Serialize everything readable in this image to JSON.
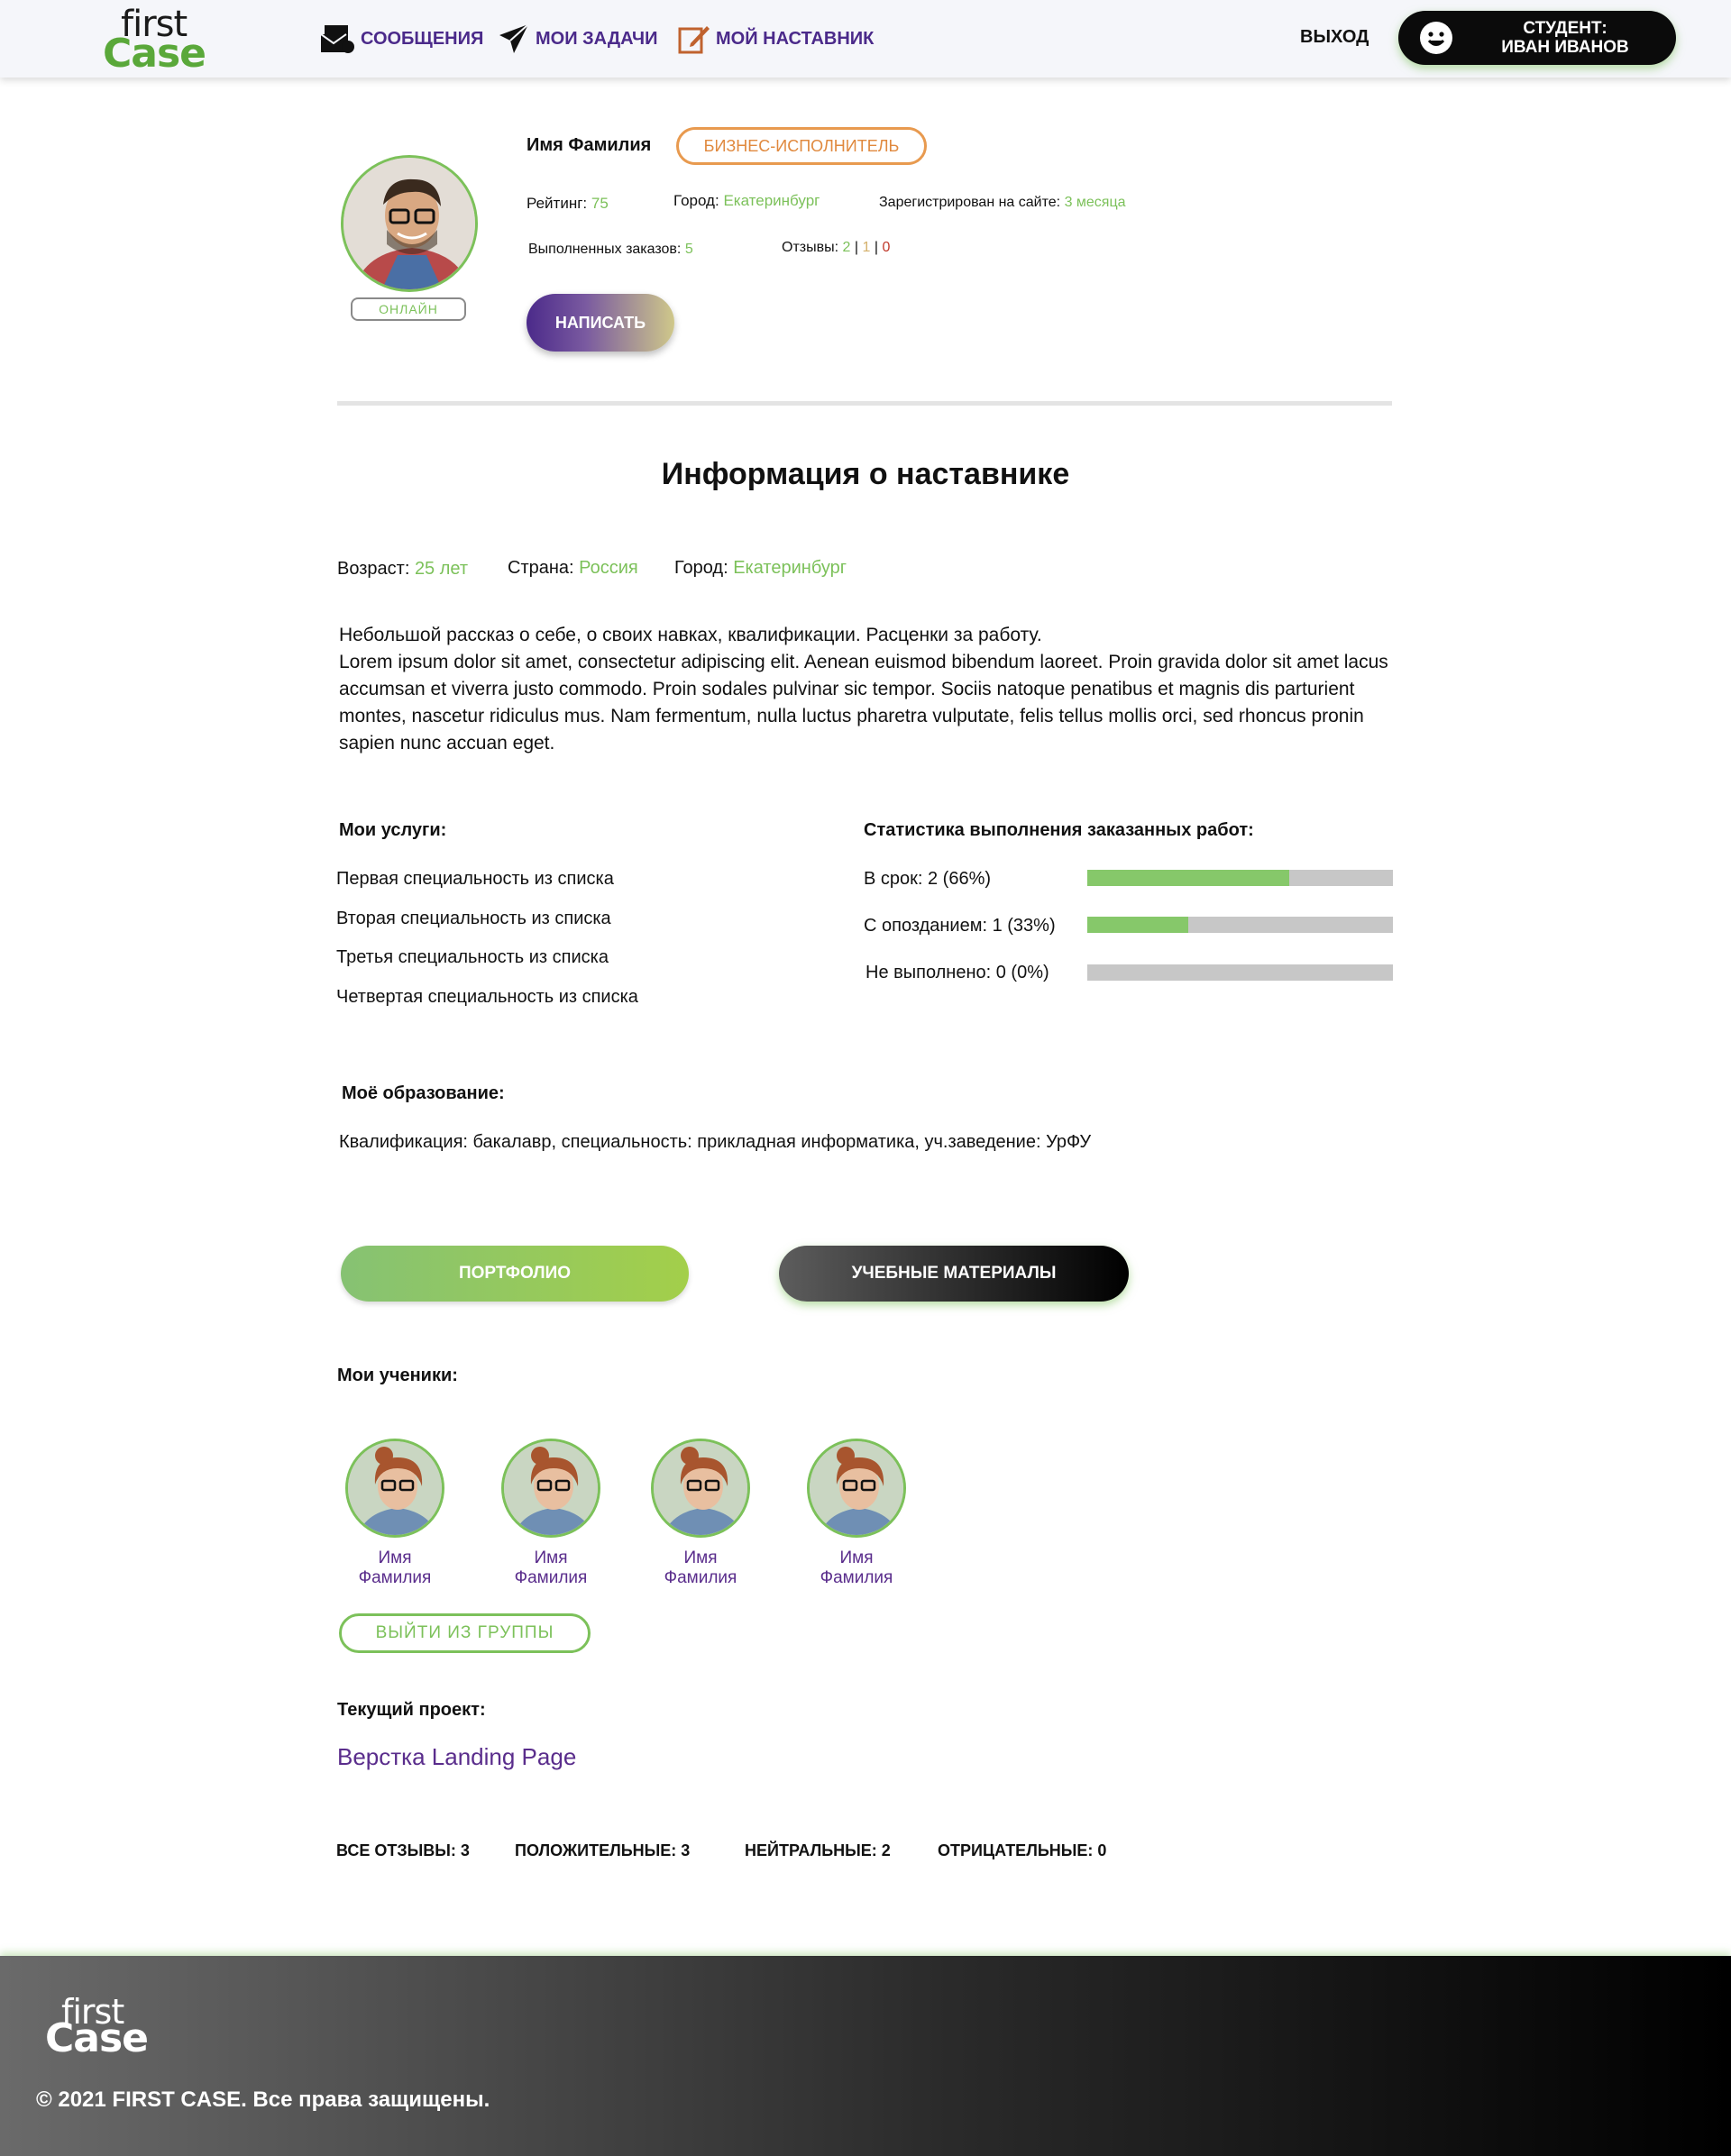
{
  "header": {
    "logo_first": "first",
    "logo_case": "Case",
    "nav": [
      {
        "label": "СООБЩЕНИЯ",
        "icon": "envelope-icon"
      },
      {
        "label": "МОИ ЗАДАЧИ",
        "icon": "send-icon"
      },
      {
        "label": "МОЙ НАСТАВНИК",
        "icon": "edit-icon"
      }
    ],
    "logout": "ВЫХОД",
    "student_role": "СТУДЕНТ:",
    "student_name": "ИВАН ИВАНОВ",
    "student_icon": "smile-icon"
  },
  "profile": {
    "name": "Имя Фамилия",
    "role": "БИЗНЕС-ИСПОЛНИТЕЛЬ",
    "online": "ОНЛАЙН",
    "rating_label": "Рейтинг:",
    "rating_value": "75",
    "city_label": "Город:",
    "city_value": "Екатеринбург",
    "registered_label": "Зарегистрирован на сайте:",
    "registered_value": "3 месяца",
    "orders_label": "Выполненных заказов:",
    "orders_value": "5",
    "reviews_label": "Отзывы:",
    "reviews_positive": "2",
    "reviews_neutral": "1",
    "reviews_negative": "0",
    "reviews_sep": "|",
    "write_button": "НАПИСАТЬ"
  },
  "info": {
    "title": "Информация о наставнике",
    "age_label": "Возраст:",
    "age_value": "25 лет",
    "country_label": "Страна:",
    "country_value": "Россия",
    "city_label": "Город:",
    "city_value": "Екатеринбург",
    "about_lead": "Небольшой рассказ о себе, о своих навках, квалификации. Расценки за работу.",
    "about_text": "Lorem ipsum dolor sit amet, consectetur adipiscing elit. Aenean euismod bibendum laoreet. Proin gravida dolor sit amet lacus accumsan et viverra justo commodo. Proin sodales pulvinar sic tempor. Sociis natoque penatibus et magnis dis parturient montes, nascetur ridiculus mus. Nam fermentum, nulla luctus pharetra vulputate, felis tellus mollis orci, sed rhoncus pronin sapien nunc accuan eget."
  },
  "services": {
    "title": "Мои услуги:",
    "items": [
      "Первая специальность из списка",
      "Вторая специальность из списка",
      "Третья специальность из списка",
      "Четвертая специальность из списка"
    ]
  },
  "stats": {
    "title": "Статистика выполнения заказанных работ:",
    "rows": [
      {
        "label": "В срок: 2 (66%)",
        "fraction": 0.66
      },
      {
        "label": "С опозданием: 1 (33%)",
        "fraction": 0.33
      },
      {
        "label": "Не выполнено: 0 (0%)",
        "fraction": 0
      }
    ]
  },
  "education": {
    "title": "Моё образование:",
    "text": "Квалификация: бакалавр, специальность: прикладная информатика, уч.заведение: УрФУ"
  },
  "buttons": {
    "portfolio": "ПОРТФОЛИО",
    "materials": "УЧЕБНЫЕ МАТЕРИАЛЫ"
  },
  "students": {
    "title": "Мои ученики:",
    "items": [
      {
        "first": "Имя",
        "last": "Фамилия"
      },
      {
        "first": "Имя",
        "last": "Фамилия"
      },
      {
        "first": "Имя",
        "last": "Фамилия"
      },
      {
        "first": "Имя",
        "last": "Фамилия"
      }
    ],
    "leave_button": "ВЫЙТИ ИЗ ГРУППЫ"
  },
  "project": {
    "title": "Текущий проект:",
    "name": "Верстка Landing Page"
  },
  "reviews": {
    "all": "ВСЕ ОТЗЫВЫ: 3",
    "positive": "ПОЛОЖИТЕЛЬНЫЕ: 3",
    "neutral": "НЕЙТРАЛЬНЫЕ: 2",
    "negative": "ОТРИЦАТЕЛЬНЫЕ: 0"
  },
  "footer": {
    "logo_first": "first",
    "logo_case": "Case",
    "copyright": "© 2021 FIRST CASE. Все права защищены."
  },
  "colors": {
    "accent_green": "#7cc15a",
    "accent_purple": "#5a2d8c",
    "role_orange": "#e0893e",
    "negative_red": "#c0392b"
  }
}
